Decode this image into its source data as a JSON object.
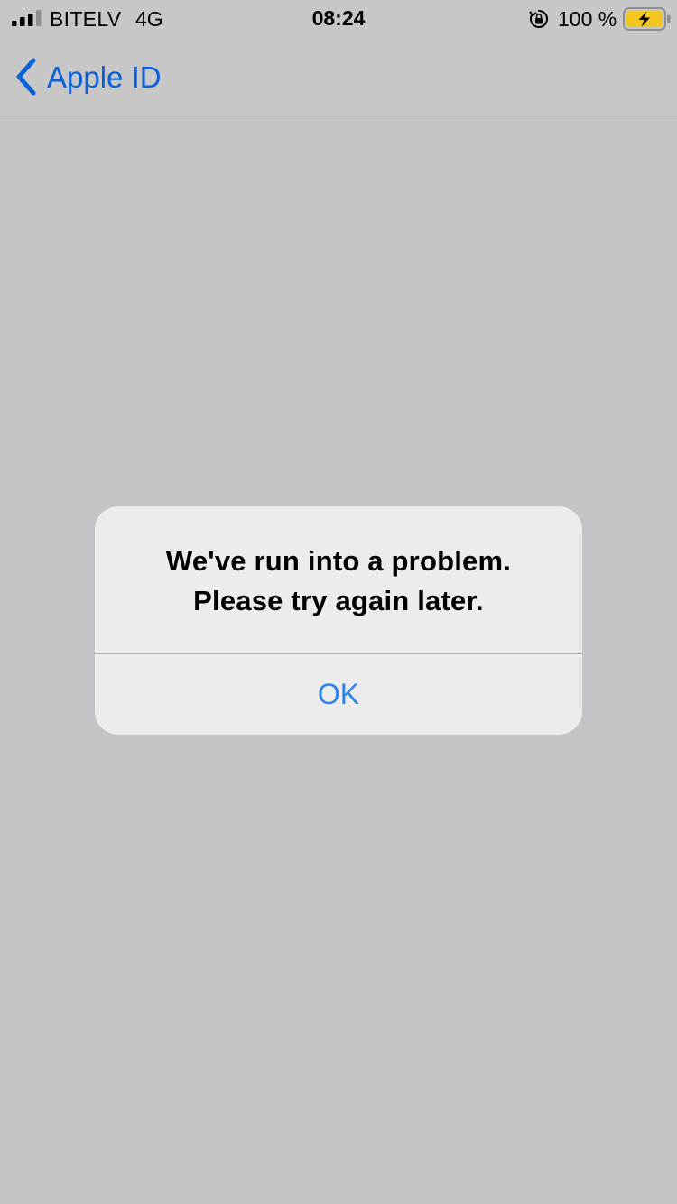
{
  "status_bar": {
    "carrier": "BITELV",
    "network": "4G",
    "time": "08:24",
    "battery_percent": "100 %",
    "battery_level": 1.0,
    "charging": true,
    "orientation_lock": true,
    "signal_bars_filled": 3,
    "signal_bars_total": 4
  },
  "nav": {
    "back_label": "Apple ID",
    "accent_color": "#0a60d6"
  },
  "alert": {
    "message_line1": "We've run into a problem.",
    "message_line2": "Please try again later.",
    "ok_label": "OK",
    "button_color": "#2a83e8"
  }
}
